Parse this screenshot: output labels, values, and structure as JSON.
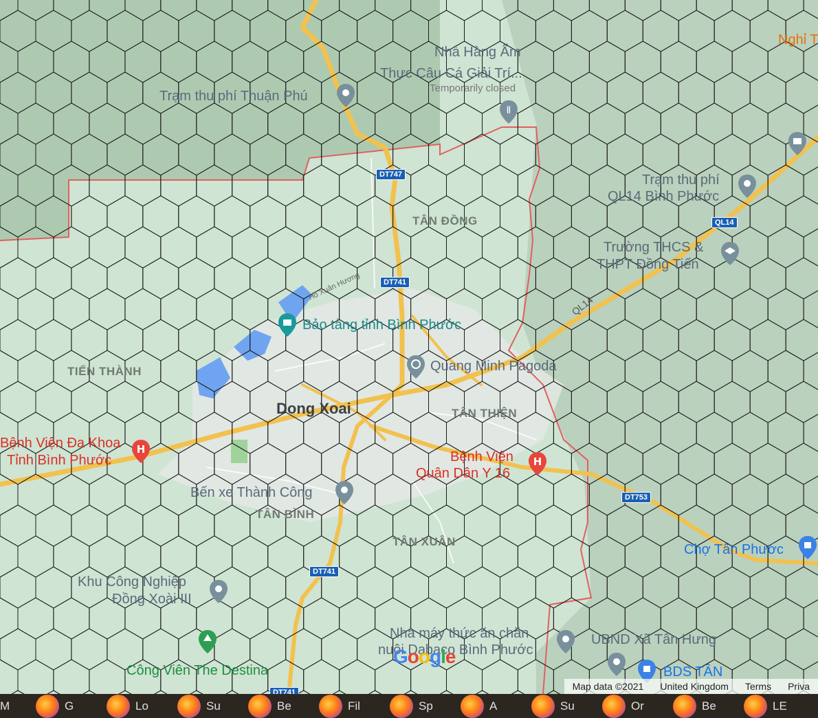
{
  "map": {
    "place_labels": [
      {
        "id": "nha-hang",
        "lines": [
          "Nhà Hàng Ẩm",
          "Thực Câu Cá Giải Trí..."
        ],
        "status": "Temporarily closed",
        "kind": "poi"
      },
      {
        "id": "tram-thuan-phu",
        "lines": [
          "Trạm thu phí Thuận Phú"
        ],
        "kind": "poi"
      },
      {
        "id": "tram-ql14",
        "lines": [
          "Trạm thu phí",
          "QL14 Bình Phước"
        ],
        "kind": "poi"
      },
      {
        "id": "truong-thcs",
        "lines": [
          "Trường THCS &",
          "THPT Đồng Tiến"
        ],
        "kind": "poi"
      },
      {
        "id": "bao-tang",
        "lines": [
          "Bảo tàng tỉnh Bình Phước"
        ],
        "kind": "museum"
      },
      {
        "id": "quang-minh",
        "lines": [
          "Quang Minh Pagoda"
        ],
        "kind": "poi"
      },
      {
        "id": "benh-vien-da-khoa",
        "lines": [
          "Bệnh Viện Đa Khoa",
          "Tỉnh Bình Phước"
        ],
        "kind": "hospital"
      },
      {
        "id": "benh-vien-quan-dan",
        "lines": [
          "Bệnh Viện",
          "Quân Dân Y 16"
        ],
        "kind": "hospital"
      },
      {
        "id": "ben-xe",
        "lines": [
          "Bến xe Thành Công"
        ],
        "kind": "poi"
      },
      {
        "id": "khu-cong-nghiep",
        "lines": [
          "Khu Công Nghiệp",
          "Đồng Xoài III"
        ],
        "kind": "poi"
      },
      {
        "id": "cong-vien",
        "lines": [
          "Công Viên The Destina"
        ],
        "kind": "park"
      },
      {
        "id": "nha-may",
        "lines": [
          "Nhà máy thức ăn chăn",
          "nuôi Dabaco Bình Phước"
        ],
        "kind": "poi"
      },
      {
        "id": "ubnd",
        "lines": [
          "UBND Xã Tân Hưng"
        ],
        "kind": "poi"
      },
      {
        "id": "bds-tan",
        "lines": [
          "BDS TÂN"
        ],
        "kind": "blue"
      },
      {
        "id": "cho-tan-phuoc",
        "lines": [
          "Chợ Tân Phước"
        ],
        "kind": "blue"
      },
      {
        "id": "nghi",
        "lines": [
          "Nghỉ T"
        ],
        "kind": "orange"
      }
    ],
    "area_labels": {
      "tan_dong": "TÂN ĐỒNG",
      "tien_thanh": "TIẾN THÀNH",
      "tan_thien": "TÂN THIỆN",
      "tan_binh": "TÂN BÌNH",
      "tan_xuan": "TÂN XUÂN"
    },
    "city_label": "Dong Xoai",
    "street_label": "Hồ Xuân Hương",
    "road_shields": {
      "dt747": "DT747",
      "dt741_a": "DT741",
      "dt741_b": "DT741",
      "dt741_c": "DT741",
      "ql14_shield": "QL14",
      "ql14_road": "QL14",
      "dt753": "DT753"
    },
    "google_logo": "Google",
    "attribution": {
      "map_data": "Map data ©2021",
      "region": "United Kingdom",
      "terms": "Terms",
      "privacy": "Priva"
    }
  },
  "taskbar": {
    "items": [
      "M",
      "G",
      "Lo",
      "Su",
      "Be",
      "Fil",
      "Sp",
      "A",
      "Su",
      "Or",
      "Be",
      "LE"
    ]
  },
  "colors": {
    "land": "#cfe4d3",
    "forest": "#a9c4ad",
    "urban": "#e6e8e6",
    "road_yellow": "#f2c14e",
    "boundary": "#e06060",
    "grid": "#1a1a1a"
  }
}
